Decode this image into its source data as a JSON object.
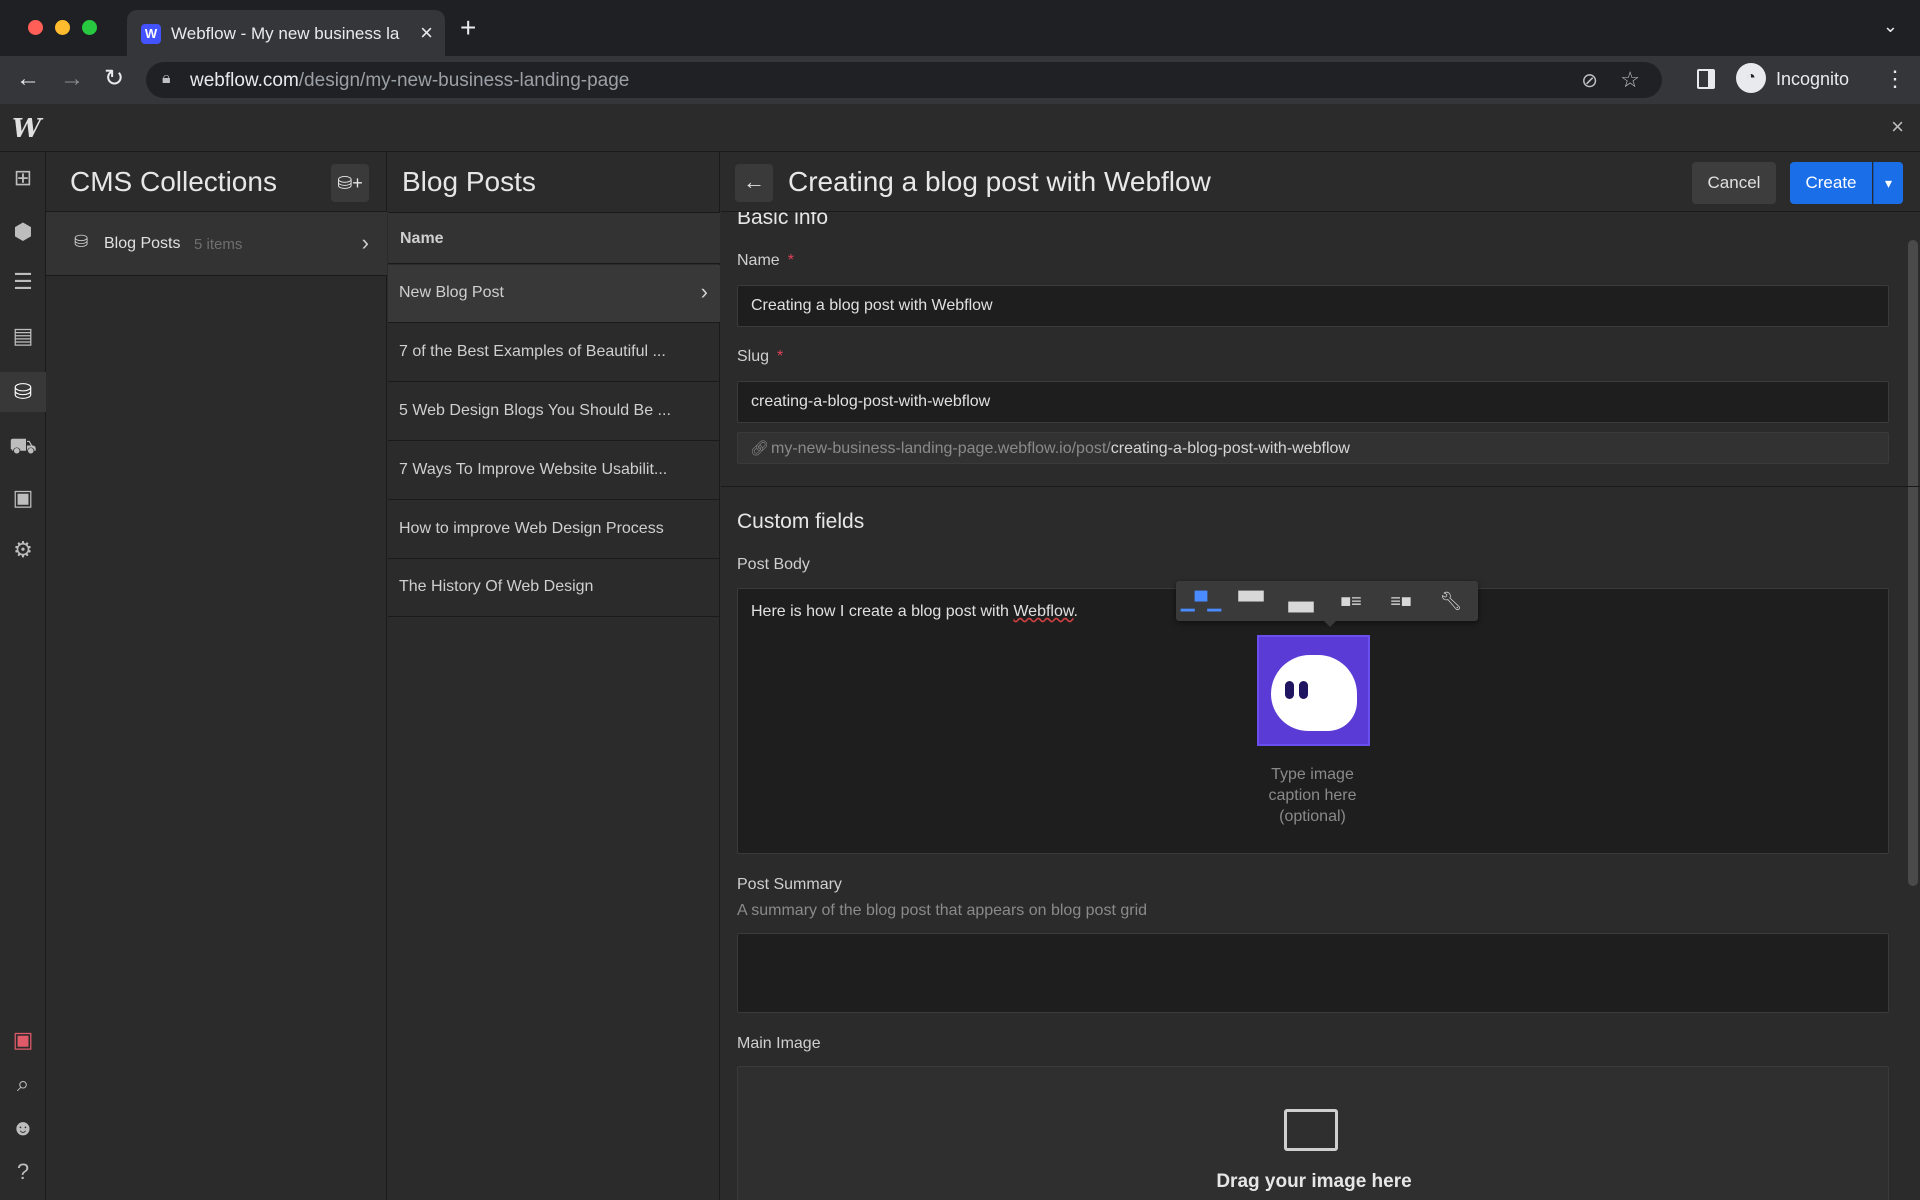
{
  "browser": {
    "tab_title": "Webflow - My new business la",
    "tab_favicon": "W",
    "url_host": "webflow.com",
    "url_path": "/design/my-new-business-landing-page",
    "profile_label": "Incognito"
  },
  "app": {
    "logo": "W",
    "rail_icons": [
      "add-icon",
      "components-icon",
      "navigator-icon",
      "pages-icon",
      "cms-icon",
      "ecommerce-icon",
      "assets-icon",
      "settings-icon",
      "audit-icon",
      "search-icon",
      "users-icon",
      "help-icon"
    ]
  },
  "cms": {
    "title": "CMS Collections",
    "collections": [
      {
        "label": "Blog Posts",
        "count": "5 items"
      }
    ]
  },
  "list": {
    "title": "Blog Posts",
    "column": "Name",
    "rows": [
      "New Blog Post",
      "7 of the Best Examples of Beautiful ...",
      "5 Web Design Blogs You Should Be ...",
      "7 Ways To Improve Website Usabilit...",
      "How to improve Web Design Process",
      "The History Of Web Design"
    ]
  },
  "editor": {
    "title": "Creating a blog post with Webflow",
    "cancel": "Cancel",
    "create": "Create",
    "basic_info": "Basic info",
    "name_label": "Name",
    "name_value": "Creating a blog post with Webflow",
    "slug_label": "Slug",
    "slug_value": "creating-a-blog-post-with-webflow",
    "url_base": "my-new-business-landing-page.webflow.io/post/",
    "url_slug": "creating-a-blog-post-with-webflow",
    "custom_fields": "Custom fields",
    "post_body_label": "Post Body",
    "post_body_text": "Here is how I create a blog post with ",
    "post_body_brand": "Webflow",
    "post_body_end": ".",
    "image_caption": "Type image caption here (optional)",
    "summary_label": "Post Summary",
    "summary_hint": "A summary of the blog post that appears on blog post grid",
    "main_image_label": "Main Image",
    "drop_label": "Drag your image here"
  },
  "colors": {
    "accent": "#1a6fe8",
    "required": "#e0405a",
    "image_bg": "#5b3bd6"
  }
}
